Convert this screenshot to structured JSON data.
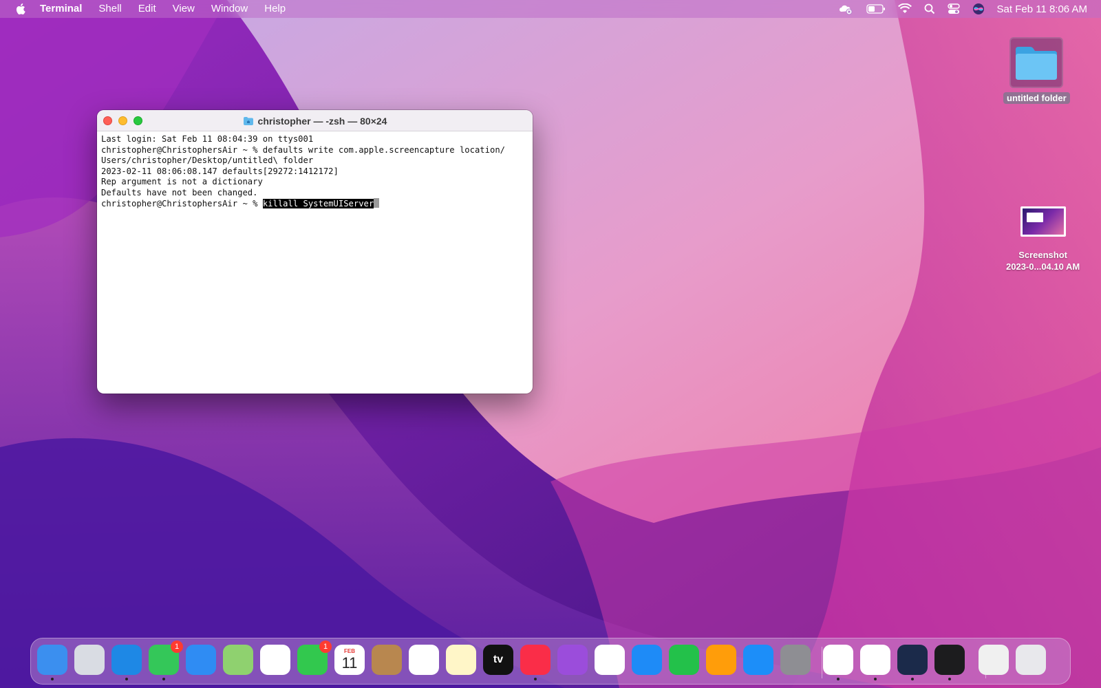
{
  "menubar": {
    "app_name": "Terminal",
    "menus": [
      "Shell",
      "Edit",
      "View",
      "Window",
      "Help"
    ],
    "clock": "Sat Feb 11  8:06 AM",
    "status_icons": [
      "icloud-disconnected-icon",
      "battery-icon",
      "wifi-icon",
      "spotlight-search-icon",
      "control-center-icon",
      "siri-icon"
    ]
  },
  "desktop": {
    "folder_label": "untitled folder",
    "screenshot_label_1": "Screenshot",
    "screenshot_label_2": "2023-0...04.10 AM"
  },
  "terminal": {
    "title": "christopher — -zsh — 80×24",
    "lines": [
      "Last login: Sat Feb 11 08:04:39 on ttys001",
      "christopher@ChristophersAir ~ % defaults write com.apple.screencapture location/",
      "Users/christopher/Desktop/untitled\\ folder",
      "2023-02-11 08:06:08.147 defaults[29272:1412172]",
      "Rep argument is not a dictionary",
      "Defaults have not been changed."
    ],
    "prompt": "christopher@ChristophersAir ~ % ",
    "selected_command": "killall SystemUIServer"
  },
  "dock": {
    "apps": [
      {
        "name": "Finder",
        "color": "#3b8fef",
        "running": true
      },
      {
        "name": "Launchpad",
        "color": "#d9dce3"
      },
      {
        "name": "Safari",
        "color": "#1e88e5",
        "running": true
      },
      {
        "name": "Messages",
        "color": "#34c759",
        "badge": "1",
        "running": true
      },
      {
        "name": "Mail",
        "color": "#2f8cf3"
      },
      {
        "name": "Maps",
        "color": "#8fd16f"
      },
      {
        "name": "Photos",
        "color": "#ffffff"
      },
      {
        "name": "FaceTime",
        "color": "#32c84e",
        "badge": "1"
      },
      {
        "name": "Calendar",
        "color": "#ffffff",
        "month": "FEB",
        "day": "11"
      },
      {
        "name": "Contacts",
        "color": "#b8874f"
      },
      {
        "name": "Reminders",
        "color": "#ffffff"
      },
      {
        "name": "Notes",
        "color": "#fff6c8"
      },
      {
        "name": "TV",
        "color": "#111111",
        "text": "tv"
      },
      {
        "name": "Music",
        "color": "#fa2d48",
        "running": true
      },
      {
        "name": "Podcasts",
        "color": "#9b4ddb"
      },
      {
        "name": "News",
        "color": "#ffffff"
      },
      {
        "name": "Keynote",
        "color": "#1e8bf7"
      },
      {
        "name": "Numbers",
        "color": "#23c14a"
      },
      {
        "name": "Pages",
        "color": "#ff9d0a"
      },
      {
        "name": "App Store",
        "color": "#1c8ef9"
      },
      {
        "name": "System Preferences",
        "color": "#8e8e93"
      },
      {
        "name": "Chrome",
        "color": "#ffffff",
        "running": true
      },
      {
        "name": "Word",
        "color": "#ffffff",
        "running": true
      },
      {
        "name": "Steam",
        "color": "#1b2a4a",
        "running": true
      },
      {
        "name": "Terminal",
        "color": "#1c1c1e",
        "running": true
      },
      {
        "name": "Screenshot Preview",
        "color": "#f0f0f0"
      },
      {
        "name": "Trash",
        "color": "#e8e8ec"
      }
    ]
  }
}
